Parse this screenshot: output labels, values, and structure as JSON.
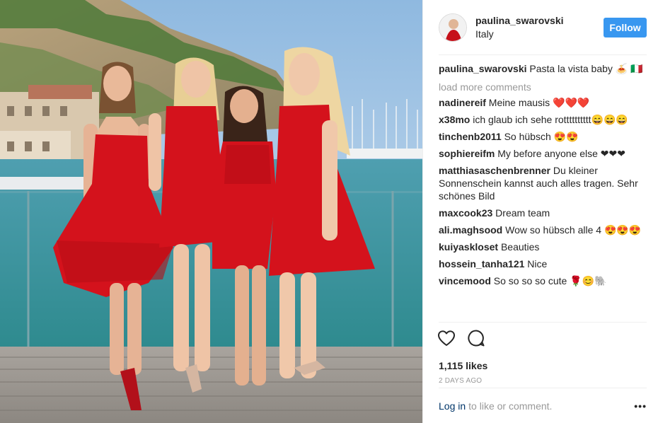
{
  "header": {
    "username": "paulina_swarovski",
    "location": "Italy",
    "follow_label": "Follow"
  },
  "caption": {
    "username": "paulina_swarovski",
    "text": "Pasta la vista baby 🍝 🇮🇹"
  },
  "load_more": "load more comments",
  "comments": [
    {
      "user": "nadinereif",
      "text": "Meine mausis ❤️❤️❤️"
    },
    {
      "user": "x38mo",
      "text": "ich glaub ich sehe rotttttttttt😄😄😄"
    },
    {
      "user": "tinchenb2011",
      "text": "So hübsch 😍😍"
    },
    {
      "user": "sophiereifm",
      "text": "My before anyone else ❤❤❤"
    },
    {
      "user": "matthiasaschenbrenner",
      "text": "Du kleiner Sonnenschein kannst auch alles tragen. Sehr schönes Bild"
    },
    {
      "user": "maxcook23",
      "text": "Dream team"
    },
    {
      "user": "ali.maghsood",
      "text": "Wow so hübsch alle 4 😍😍😍"
    },
    {
      "user": "kuiyaskloset",
      "text": "Beauties"
    },
    {
      "user": "hossein_tanha121",
      "text": "Nice"
    },
    {
      "user": "vincemood",
      "text": "So so so so cute 🌹😊🐘"
    }
  ],
  "likes": "1,115 likes",
  "time_ago": "2 DAYS AGO",
  "footer": {
    "login_label": "Log in",
    "rest_text": "to like or comment.",
    "more_label": "•••"
  },
  "icons": {
    "like": "heart-icon",
    "comment": "comment-icon",
    "more": "more-options-icon"
  },
  "colors": {
    "accent": "#3897f0",
    "dress": "#d4121c",
    "link": "#003569",
    "muted": "#999999"
  }
}
